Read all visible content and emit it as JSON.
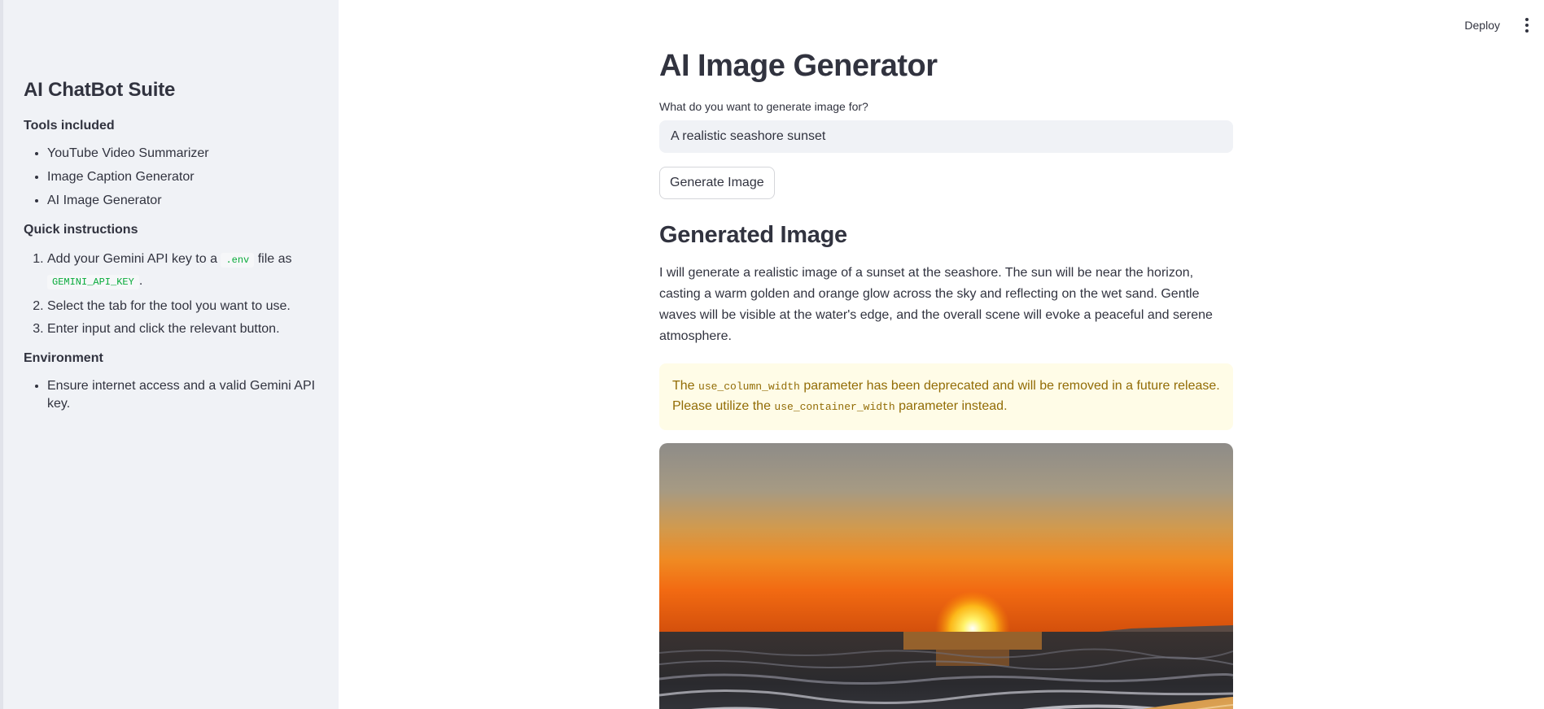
{
  "header": {
    "deploy_label": "Deploy",
    "menu_icon": "kebab-vertical-icon"
  },
  "sidebar": {
    "title": "AI ChatBot Suite",
    "tools_heading": "Tools included",
    "tools": [
      "YouTube Video Summarizer",
      "Image Caption Generator",
      "AI Image Generator"
    ],
    "instructions_heading": "Quick instructions",
    "instructions": {
      "step1_pre": "Add your Gemini API key to a",
      "step1_code1": ".env",
      "step1_mid": "file as",
      "step1_code2": "GEMINI_API_KEY",
      "step1_post": ".",
      "step2": "Select the tab for the tool you want to use.",
      "step3": "Enter input and click the relevant button."
    },
    "environment_heading": "Environment",
    "environment_items": [
      "Ensure internet access and a valid Gemini API key."
    ]
  },
  "main": {
    "title": "AI Image Generator",
    "input_label": "What do you want to generate image for?",
    "input_value": "A realistic seashore sunset",
    "generate_button": "Generate Image",
    "result_heading": "Generated Image",
    "description": "I will generate a realistic image of a sunset at the seashore. The sun will be near the horizon, casting a warm golden and orange glow across the sky and reflecting on the wet sand. Gentle waves will be visible at the water's edge, and the overall scene will evoke a peaceful and serene atmosphere.",
    "warning": {
      "part1": "The",
      "code1": "use_column_width",
      "part2": "parameter has been deprecated and will be removed in a future release. Please utilize the",
      "code2": "use_container_width",
      "part3": "parameter instead."
    }
  },
  "colors": {
    "sidebar_bg": "#f0f2f6",
    "warning_bg": "#fffce7",
    "warning_text": "#926c05",
    "code_green": "#09ab3b",
    "text": "#31333f"
  }
}
